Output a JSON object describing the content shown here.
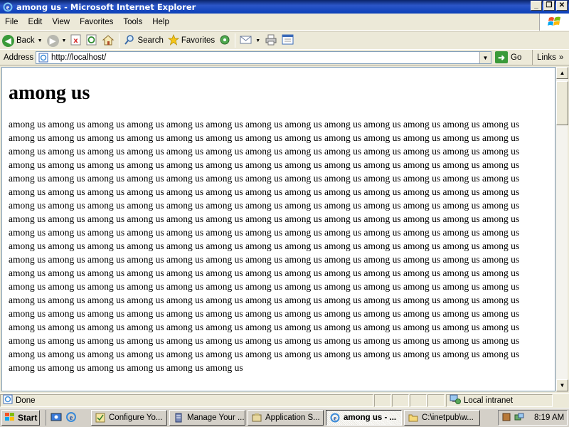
{
  "window": {
    "title": "among us - Microsoft Internet Explorer"
  },
  "menu": [
    "File",
    "Edit",
    "View",
    "Favorites",
    "Tools",
    "Help"
  ],
  "toolbar": {
    "back_label": "Back",
    "search_label": "Search",
    "favorites_label": "Favorites"
  },
  "address": {
    "label": "Address",
    "url": "http://localhost/",
    "go_label": "Go",
    "links_label": "Links"
  },
  "page": {
    "heading": "among us",
    "body_phrase": "among us",
    "body_repeat": 240
  },
  "status": {
    "text": "Done",
    "zone": "Local intranet"
  },
  "taskbar": {
    "start_label": "Start",
    "tasks": [
      {
        "label": "Configure Yo...",
        "icon": "wizard-icon",
        "active": false
      },
      {
        "label": "Manage Your ...",
        "icon": "server-icon",
        "active": false
      },
      {
        "label": "Application S...",
        "icon": "app-server-icon",
        "active": false
      },
      {
        "label": "among us - ...",
        "icon": "ie-icon",
        "active": true
      },
      {
        "label": "C:\\inetpub\\w...",
        "icon": "folder-icon",
        "active": false
      }
    ],
    "clock": "8:19 AM"
  }
}
